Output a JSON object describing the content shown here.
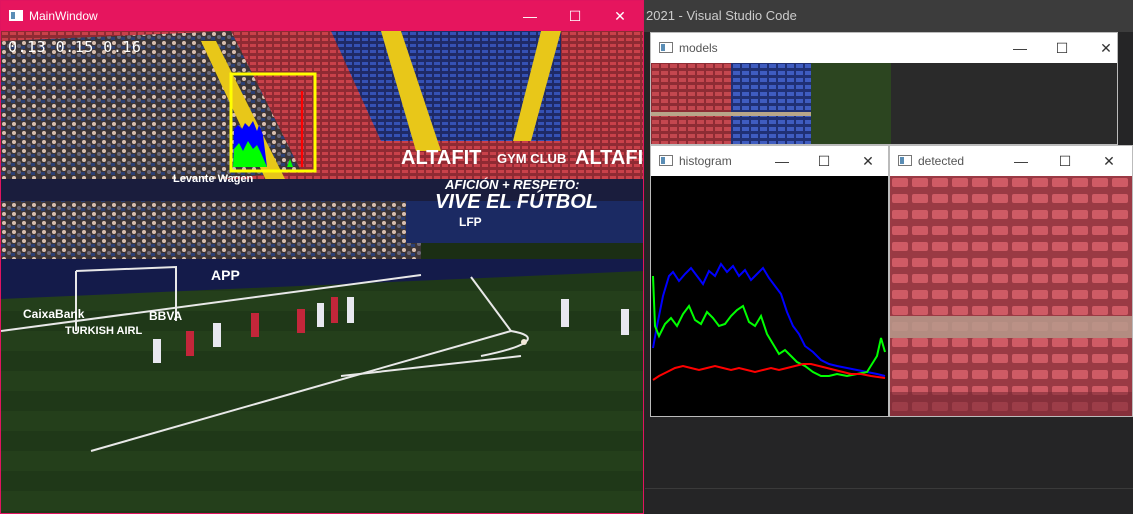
{
  "vscode": {
    "title": "2021 - Visual Studio Code"
  },
  "main_window": {
    "title": "MainWindow",
    "scores": "0.13  0.15  0.16",
    "banners": {
      "altafit_1": "ALTAFIT",
      "gym_club": "GYM CLUB",
      "altafit_2": "ALTAFIT",
      "slogan_line1": "AFICIÓN + RESPETO:",
      "slogan_line2": "VIVE EL FÚTBOL",
      "lfp": "LFP",
      "levante": "Levante Wagen",
      "bbva": "BBVA",
      "caixabank": "CaixaBank",
      "turkish": "TURKISH AIRL",
      "app": "APP"
    }
  },
  "models_window": {
    "title": "models"
  },
  "histogram_window": {
    "title": "histogram"
  },
  "detected_window": {
    "title": "detected"
  },
  "controls": {
    "minimize": "—",
    "maximize": "☐",
    "close": "✕"
  },
  "colors": {
    "main_title": "#e6155e",
    "box": "#ffff00",
    "hist_blue": "#0000ff",
    "hist_green": "#00ff00",
    "hist_red": "#ff0000"
  }
}
